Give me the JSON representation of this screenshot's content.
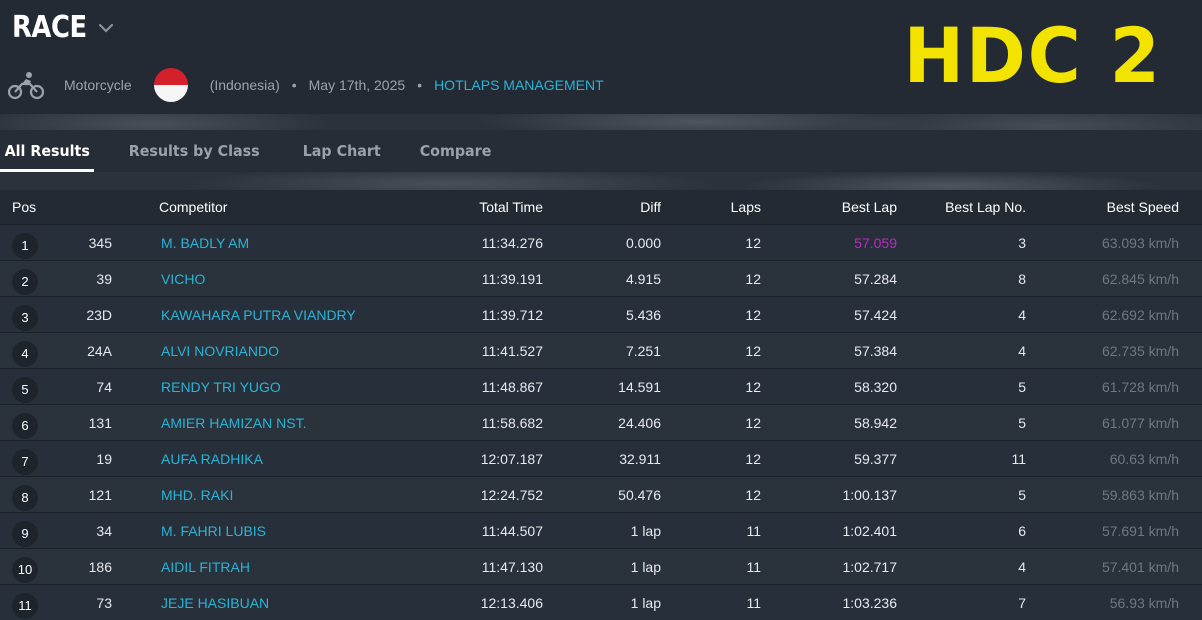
{
  "event": {
    "title": "RACE",
    "category": "Motorcycle",
    "country": "(Indonesia)",
    "date": "May 17th, 2025",
    "organizer": "HOTLAPS MANAGEMENT",
    "logo_text": "HDC 2"
  },
  "colors": {
    "accent": "#2bb3d6",
    "logo": "#f2e300",
    "fastest_lap": "#c026c7",
    "background": "#232a33"
  },
  "icons": {
    "sport": "motorcycle-icon",
    "flag": "indonesia-flag-icon",
    "dropdown": "chevron-down-icon"
  },
  "tabs": [
    {
      "label": "All Results",
      "active": true
    },
    {
      "label": "Results by Class",
      "active": false
    },
    {
      "label": "Lap Chart",
      "active": false
    },
    {
      "label": "Compare",
      "active": false
    }
  ],
  "table": {
    "headers": {
      "pos": "Pos",
      "competitor": "Competitor",
      "total_time": "Total Time",
      "diff": "Diff",
      "laps": "Laps",
      "best_lap": "Best Lap",
      "best_lap_no": "Best Lap No.",
      "best_speed": "Best Speed"
    },
    "rows": [
      {
        "pos": "1",
        "num": "345",
        "competitor": "M. BADLY AM",
        "total_time": "11:34.276",
        "diff": "0.000",
        "laps": "12",
        "best_lap": "57.059",
        "best_lap_no": "3",
        "best_speed": "63.093 km/h"
      },
      {
        "pos": "2",
        "num": "39",
        "competitor": "VICHO",
        "total_time": "11:39.191",
        "diff": "4.915",
        "laps": "12",
        "best_lap": "57.284",
        "best_lap_no": "8",
        "best_speed": "62.845 km/h"
      },
      {
        "pos": "3",
        "num": "23D",
        "competitor": "KAWAHARA PUTRA VIANDRY",
        "total_time": "11:39.712",
        "diff": "5.436",
        "laps": "12",
        "best_lap": "57.424",
        "best_lap_no": "4",
        "best_speed": "62.692 km/h"
      },
      {
        "pos": "4",
        "num": "24A",
        "competitor": "ALVI NOVRIANDO",
        "total_time": "11:41.527",
        "diff": "7.251",
        "laps": "12",
        "best_lap": "57.384",
        "best_lap_no": "4",
        "best_speed": "62.735 km/h"
      },
      {
        "pos": "5",
        "num": "74",
        "competitor": "RENDY TRI YUGO",
        "total_time": "11:48.867",
        "diff": "14.591",
        "laps": "12",
        "best_lap": "58.320",
        "best_lap_no": "5",
        "best_speed": "61.728 km/h"
      },
      {
        "pos": "6",
        "num": "131",
        "competitor": "AMIER HAMIZAN NST.",
        "total_time": "11:58.682",
        "diff": "24.406",
        "laps": "12",
        "best_lap": "58.942",
        "best_lap_no": "5",
        "best_speed": "61.077 km/h"
      },
      {
        "pos": "7",
        "num": "19",
        "competitor": "AUFA RADHIKA",
        "total_time": "12:07.187",
        "diff": "32.911",
        "laps": "12",
        "best_lap": "59.377",
        "best_lap_no": "11",
        "best_speed": "60.63 km/h"
      },
      {
        "pos": "8",
        "num": "121",
        "competitor": "MHD. RAKI",
        "total_time": "12:24.752",
        "diff": "50.476",
        "laps": "12",
        "best_lap": "1:00.137",
        "best_lap_no": "5",
        "best_speed": "59.863 km/h"
      },
      {
        "pos": "9",
        "num": "34",
        "competitor": "M. FAHRI LUBIS",
        "total_time": "11:44.507",
        "diff": "1 lap",
        "laps": "11",
        "best_lap": "1:02.401",
        "best_lap_no": "6",
        "best_speed": "57.691 km/h"
      },
      {
        "pos": "10",
        "num": "186",
        "competitor": "AIDIL FITRAH",
        "total_time": "11:47.130",
        "diff": "1 lap",
        "laps": "11",
        "best_lap": "1:02.717",
        "best_lap_no": "4",
        "best_speed": "57.401 km/h"
      },
      {
        "pos": "11",
        "num": "73",
        "competitor": "JEJE HASIBUAN",
        "total_time": "12:13.406",
        "diff": "1 lap",
        "laps": "11",
        "best_lap": "1:03.236",
        "best_lap_no": "7",
        "best_speed": "56.93 km/h"
      }
    ]
  }
}
